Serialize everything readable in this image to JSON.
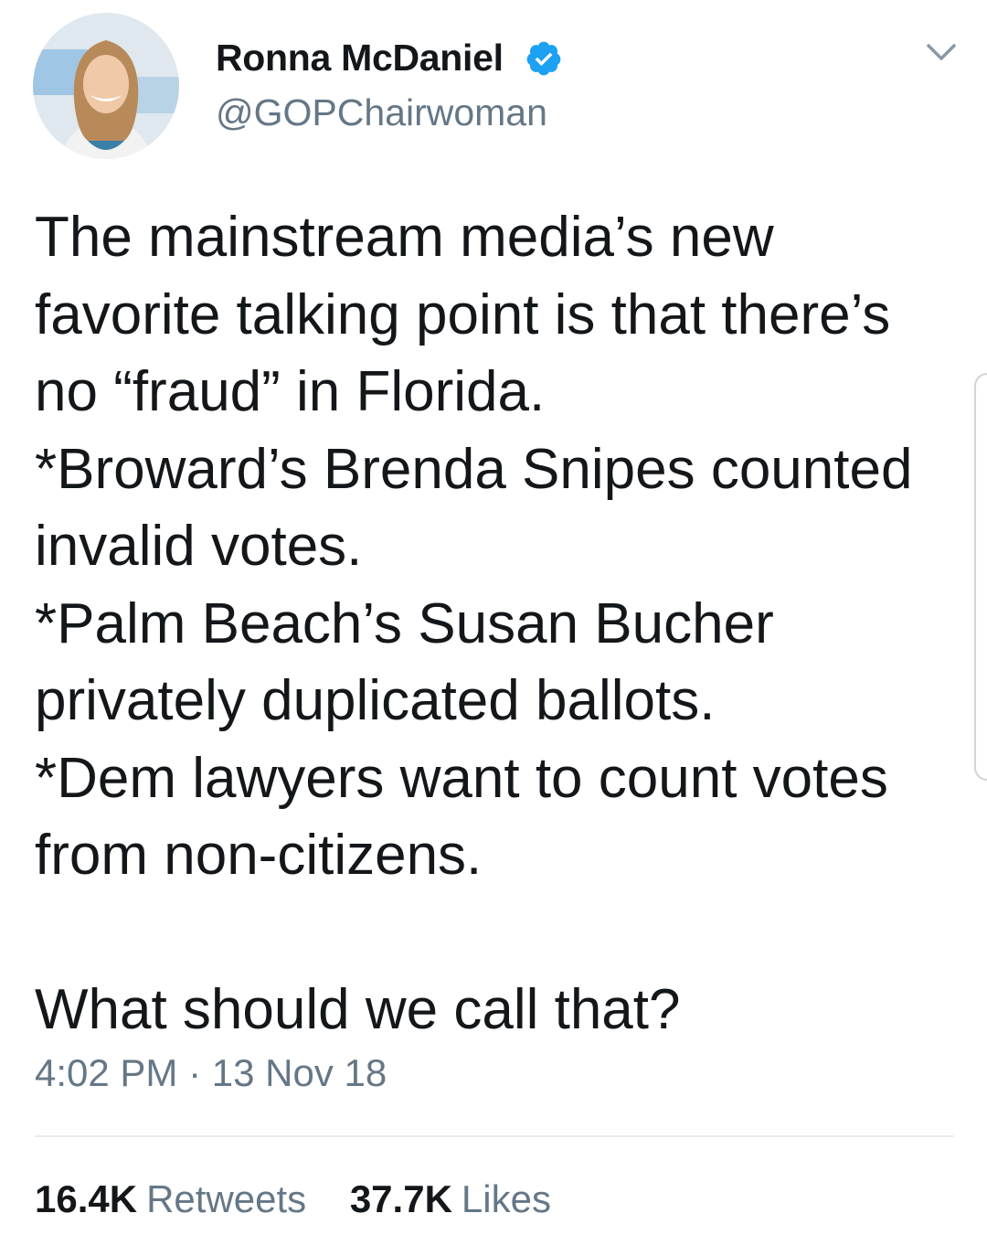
{
  "tweet": {
    "author": {
      "display_name": "Ronna McDaniel",
      "handle": "@GOPChairwoman",
      "verified": true
    },
    "text": "The mainstream media’s new\nfavorite talking point is that there’s\nno “fraud” in Florida.\n*Broward’s Brenda Snipes counted\ninvalid votes.\n*Palm Beach’s Susan Bucher\nprivately duplicated ballots.\n*Dem lawyers want to count votes\nfrom non-citizens.\n\nWhat should we call that?",
    "timestamp": "4:02 PM · 13 Nov 18",
    "stats": {
      "retweets_count": "16.4K",
      "retweets_label": "Retweets",
      "likes_count": "37.7K",
      "likes_label": "Likes"
    }
  },
  "icons": {
    "verified": "verified-badge-icon",
    "menu": "chevron-down-icon"
  },
  "colors": {
    "text_primary": "#14171a",
    "text_secondary": "#657786",
    "verified_blue": "#1da1f2",
    "divider": "#e6ecf0"
  }
}
